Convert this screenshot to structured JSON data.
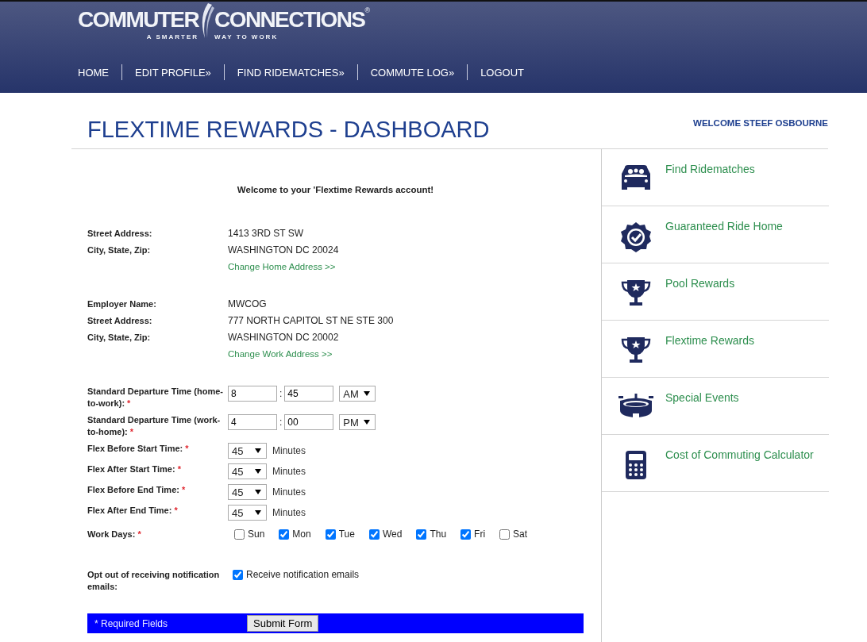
{
  "header": {
    "logo": {
      "left": "COMMUTER",
      "right": "CONNECTIONS",
      "mark": "®",
      "tagline_left": "A SMARTER",
      "tagline_right": "WAY TO WORK"
    },
    "nav": [
      {
        "label": "HOME"
      },
      {
        "label": "EDIT PROFILE»"
      },
      {
        "label": "FIND RIDEMATCHES»"
      },
      {
        "label": "COMMUTE LOG»"
      },
      {
        "label": "LOGOUT"
      }
    ]
  },
  "page_title": "FLEXTIME REWARDS - DASHBOARD",
  "welcome_user": "WELCOME STEEF OSBOURNE",
  "intro": "Welcome to your 'Flextime Rewards account!",
  "home_address": {
    "rows": [
      {
        "label": "Street Address:",
        "value": "1413 3RD ST SW"
      },
      {
        "label": "City, State, Zip:",
        "value": "WASHINGTON DC 20024"
      }
    ],
    "link": "Change Home Address >>"
  },
  "work_address": {
    "rows": [
      {
        "label": "Employer Name:",
        "value": "MWCOG"
      },
      {
        "label": "Street Address:",
        "value": "777 NORTH CAPITOL ST NE STE 300"
      },
      {
        "label": "City, State, Zip:",
        "value": "WASHINGTON DC 20002"
      }
    ],
    "link": "Change Work Address >>"
  },
  "departure_times": [
    {
      "label": "Standard Departure Time (home-to-work):",
      "asterisk": "*",
      "hour": "8",
      "separator": ":",
      "minute": "45",
      "period": "AM"
    },
    {
      "label": "Standard Departure Time (work-to-home):",
      "asterisk": "*",
      "hour": "4",
      "separator": ":",
      "minute": "00",
      "period": "PM"
    }
  ],
  "flex_times": [
    {
      "label": "Flex Before Start Time:",
      "asterisk": "*",
      "value": "45",
      "unit": "Minutes"
    },
    {
      "label": "Flex After Start Time:",
      "asterisk": "*",
      "value": "45",
      "unit": "Minutes"
    },
    {
      "label": "Flex Before End Time:",
      "asterisk": "*",
      "value": "45",
      "unit": "Minutes"
    },
    {
      "label": "Flex After End Time:",
      "asterisk": "*",
      "value": "45",
      "unit": "Minutes"
    }
  ],
  "work_days": {
    "label": "Work Days:",
    "asterisk": "*",
    "days": [
      {
        "label": "Sun",
        "checked": false
      },
      {
        "label": "Mon",
        "checked": true
      },
      {
        "label": "Tue",
        "checked": true
      },
      {
        "label": "Wed",
        "checked": true
      },
      {
        "label": "Thu",
        "checked": true
      },
      {
        "label": "Fri",
        "checked": true
      },
      {
        "label": "Sat",
        "checked": false
      }
    ]
  },
  "opt_out": {
    "label": "Opt out of receiving notification emails:",
    "option": {
      "label": "Receive notification emails",
      "checked": true
    }
  },
  "footer": {
    "note": "* Required Fields",
    "submit": "Submit Form"
  },
  "sidebar": {
    "items": [
      {
        "label": "Find Ridematches",
        "kind": "car"
      },
      {
        "label": "Guaranteed Ride Home",
        "kind": "badge"
      },
      {
        "label": "Pool Rewards",
        "kind": "trophy"
      },
      {
        "label": "Flextime Rewards",
        "kind": "trophy"
      },
      {
        "label": "Special Events",
        "kind": "stadium"
      },
      {
        "label": "Cost of Commuting Calculator",
        "kind": "calculator"
      }
    ]
  }
}
